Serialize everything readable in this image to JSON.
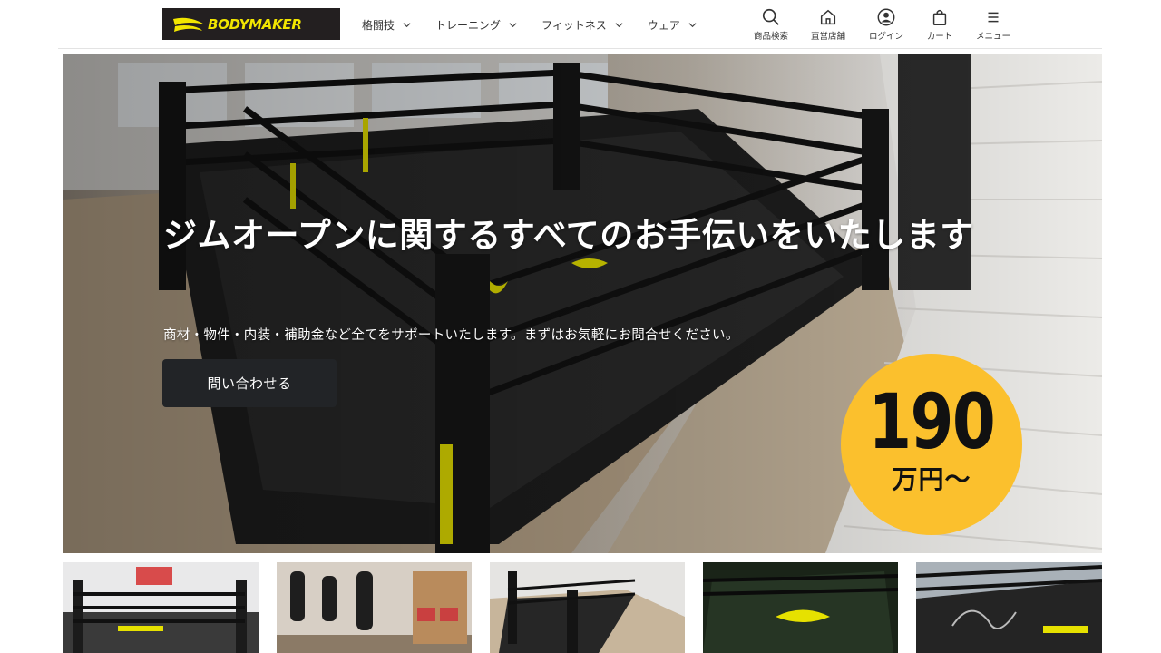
{
  "header": {
    "logo_text": "BODYMAKER",
    "nav": [
      {
        "label": "格闘技"
      },
      {
        "label": "トレーニング"
      },
      {
        "label": "フィットネス"
      },
      {
        "label": "ウェア"
      }
    ],
    "utilities": [
      {
        "label": "商品検索",
        "icon": "search-icon"
      },
      {
        "label": "直営店舗",
        "icon": "store-icon"
      },
      {
        "label": "ログイン",
        "icon": "user-icon"
      },
      {
        "label": "カート",
        "icon": "cart-icon"
      },
      {
        "label": "メニュー",
        "icon": "menu-icon"
      }
    ]
  },
  "hero": {
    "title": "ジムオープンに関するすべてのお手伝いをいたします",
    "subtitle": "商材・物件・内装・補助金など全てをサポートいたします。まずはお気軽にお問合せください。",
    "cta_label": "問い合わせる",
    "price_number": "190",
    "price_unit": "万円〜"
  },
  "thumbnails": [
    {
      "alt": "gym-ring-photo-1"
    },
    {
      "alt": "gym-punching-bags-photo"
    },
    {
      "alt": "gym-ring-photo-2"
    },
    {
      "alt": "gym-ring-photo-3"
    },
    {
      "alt": "gym-ring-style-photo"
    }
  ],
  "colors": {
    "brand_yellow": "#f2e600",
    "badge_yellow": "#fbc02d",
    "button_dark": "#222427"
  }
}
